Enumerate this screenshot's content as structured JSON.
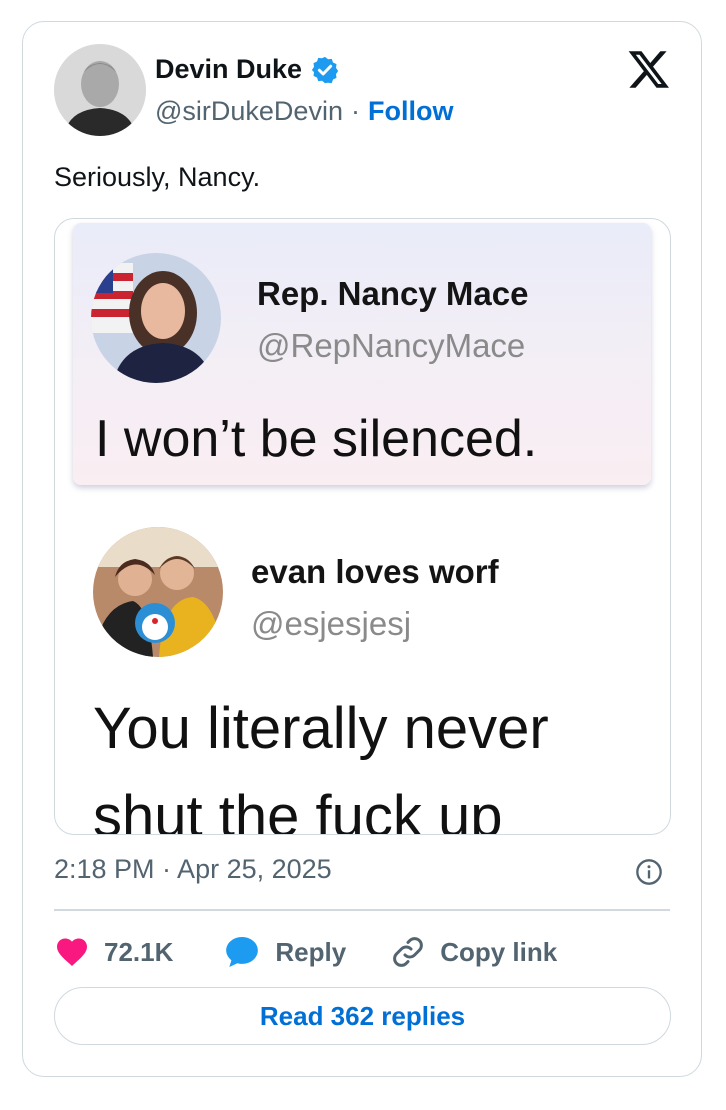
{
  "author": {
    "name": "Devin Duke",
    "handle": "@sirDukeDevin",
    "separator": "·",
    "follow_label": "Follow",
    "verified": true
  },
  "tweet": {
    "text": "Seriously, Nancy.",
    "timestamp": "2:18 PM · Apr 25, 2025"
  },
  "media": {
    "post1": {
      "name": "Rep. Nancy Mace",
      "handle": "@RepNancyMace",
      "text": "I won’t be silenced."
    },
    "post2": {
      "name": "evan loves worf",
      "handle": "@esjesjesj",
      "text_line1": "You literally never",
      "text_line2": "shut the fuck up"
    }
  },
  "actions": {
    "like_count": "72.1K",
    "reply_label": "Reply",
    "copy_link_label": "Copy link"
  },
  "read_replies_label": "Read 362 replies",
  "colors": {
    "accent": "#006fd6",
    "verified": "#1d9bf0",
    "like": "#f91880",
    "border": "#cfd9de",
    "secondary_text": "#536471"
  },
  "icons": {
    "brand": "x-logo-icon",
    "verified": "verified-badge-icon",
    "info": "info-icon",
    "like": "heart-icon",
    "reply": "speech-bubble-icon",
    "copy_link": "link-icon"
  }
}
